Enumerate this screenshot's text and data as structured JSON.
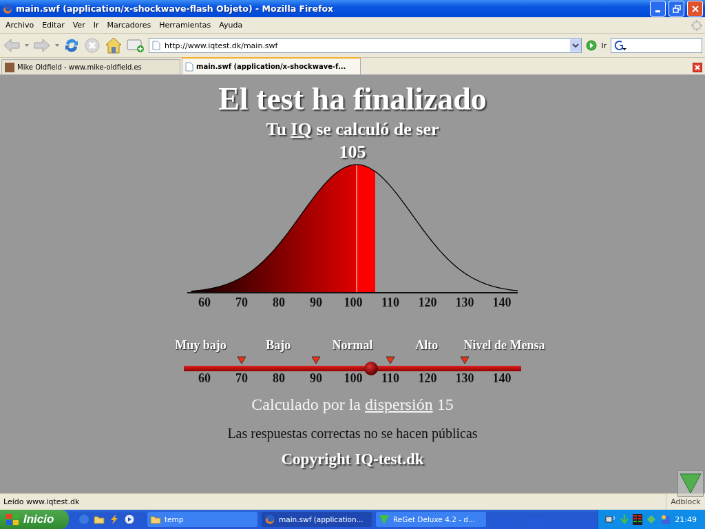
{
  "window": {
    "title": "main.swf (application/x-shockwave-flash Objeto) - Mozilla Firefox"
  },
  "menu": [
    "Archivo",
    "Editar",
    "Ver",
    "Ir",
    "Marcadores",
    "Herramientas",
    "Ayuda"
  ],
  "address": {
    "value": "http://www.iqtest.dk/main.swf",
    "go_label": "Ir"
  },
  "tabs": [
    {
      "label": "Mike Oldfield - www.mike-oldfield.es",
      "selected": false
    },
    {
      "label": "main.swf (application/x-shockwave-f...",
      "selected": true
    }
  ],
  "content": {
    "title": "El test ha finalizado",
    "subtitle": {
      "before": "Tu ",
      "link": "IQ",
      "after": " se calculó de ser"
    },
    "score": "105",
    "axis_labels": [
      "60",
      "70",
      "80",
      "90",
      "100",
      "110",
      "120",
      "130",
      "140"
    ],
    "scale": {
      "categories": [
        "Muy bajo",
        "Bajo",
        "Normal",
        "Alto",
        "Nivel de Mensa"
      ],
      "level": 0.555,
      "labels": [
        "60",
        "70",
        "80",
        "90",
        "100",
        "110",
        "120",
        "130",
        "140"
      ]
    },
    "dispersion": {
      "before": "Calculado por la ",
      "link": "dispersión",
      "after": " 15"
    },
    "note": "Las respuestas correctas no se hacen públicas",
    "copyright": "Copyright IQ-test.dk"
  },
  "status_bar": {
    "text": "Leído www.iqtest.dk",
    "adblock": "Adblock"
  },
  "taskbar": {
    "start": "Inicio",
    "tasks": [
      {
        "label": "temp",
        "kind": "folder",
        "selected": false
      },
      {
        "label": "main.swf (application...",
        "kind": "firefox",
        "selected": true
      },
      {
        "label": "ReGet Deluxe 4.2 - d...",
        "kind": "reget",
        "selected": false
      }
    ],
    "clock": "21:49"
  }
}
